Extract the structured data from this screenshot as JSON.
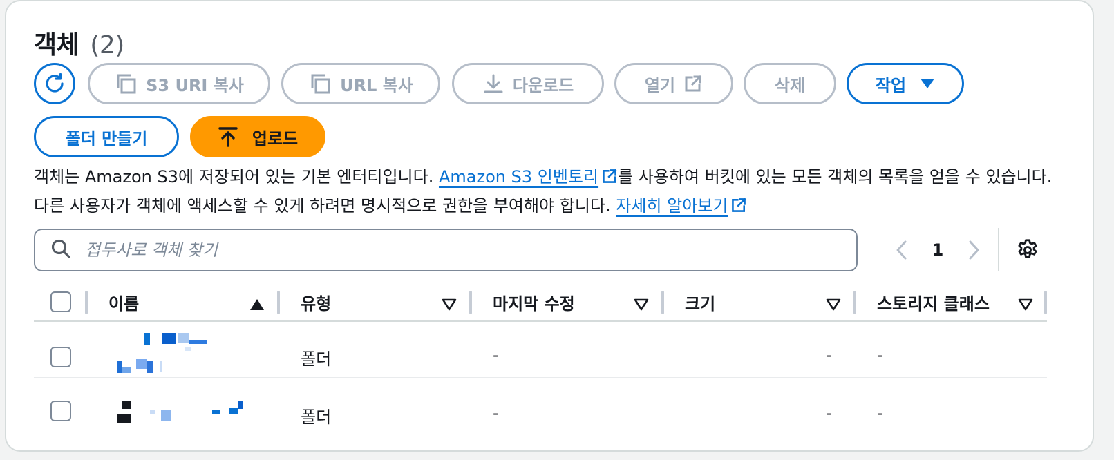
{
  "header": {
    "title": "객체",
    "count": "(2)"
  },
  "toolbar": {
    "copy_s3_uri": "S3 URI 복사",
    "copy_url": "URL 복사",
    "download": "다운로드",
    "open": "열기",
    "delete": "삭제",
    "actions": "작업",
    "create_folder": "폴더 만들기",
    "upload": "업로드"
  },
  "description": {
    "text1": "객체는 Amazon S3에 저장되어 있는 기본 엔터티입니다. ",
    "link1": "Amazon S3 인벤토리",
    "text2": "를 사용하여 버킷에 있는 모든 객체의 목록을 얻을 수 있습니다. 다른 사용자가 객체에 액세스할 수 있게 하려면 명시적으로 권한을 부여해야 합니다. ",
    "link2": "자세히 알아보기"
  },
  "search": {
    "placeholder": "접두사로 객체 찾기",
    "value": ""
  },
  "pagination": {
    "current_page": "1"
  },
  "table": {
    "columns": [
      {
        "label": "이름",
        "sort": "ascending"
      },
      {
        "label": "유형",
        "sort": "none"
      },
      {
        "label": "마지막 수정",
        "sort": "none"
      },
      {
        "label": "크기",
        "sort": "none"
      },
      {
        "label": "스토리지 클래스",
        "sort": "none"
      }
    ],
    "rows": [
      {
        "name": "[redacted]",
        "type": "폴더",
        "last_modified": "-",
        "size": "-",
        "storage_class": "-"
      },
      {
        "name": "[redacted]",
        "type": "폴더",
        "last_modified": "-",
        "size": "-",
        "storage_class": "-"
      }
    ]
  },
  "colors": {
    "accent": "#0972d3",
    "upload": "#ff9900",
    "disabled": "#9ba7b6"
  },
  "icons": [
    "refresh-icon",
    "copy-icon",
    "download-icon",
    "external-link-icon",
    "caret-down-icon",
    "upload-arrow-icon",
    "search-icon",
    "chevron-left-icon",
    "chevron-right-icon",
    "settings-gear-icon",
    "sort-ascending-icon",
    "sort-descending-icon"
  ]
}
